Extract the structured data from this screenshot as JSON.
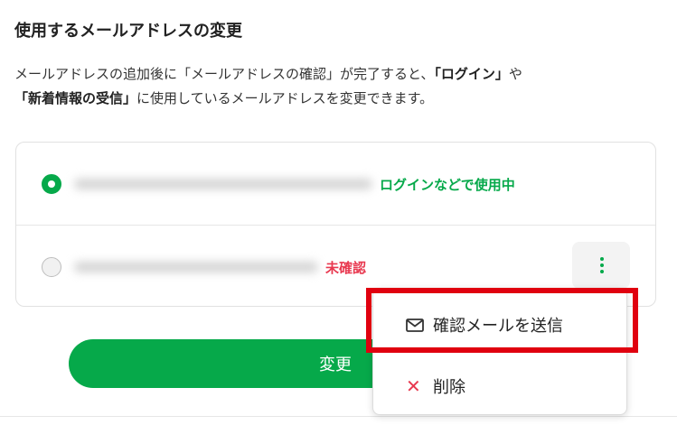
{
  "page": {
    "title": "使用するメールアドレスの変更",
    "description": {
      "line1_pre": "メールアドレスの追加後に「メールアドレスの確認」が完了すると、",
      "line1_b1": "「ログイン」",
      "line1_post": "や",
      "line2_b2": "「新着情報の受信」",
      "line2_post": "に使用しているメールアドレスを変更できます。"
    }
  },
  "emails": [
    {
      "status": "ログインなどで使用中",
      "selected": true
    },
    {
      "status": "未確認",
      "selected": false
    }
  ],
  "change_button": {
    "label": "変更"
  },
  "menu": {
    "items": [
      {
        "label": "確認メールを送信",
        "icon": "mail-icon"
      },
      {
        "label": "削除",
        "icon": "close-icon"
      }
    ]
  },
  "colors": {
    "accent": "#06a94a",
    "warning": "#e8384f",
    "highlight": "#e0000f"
  }
}
